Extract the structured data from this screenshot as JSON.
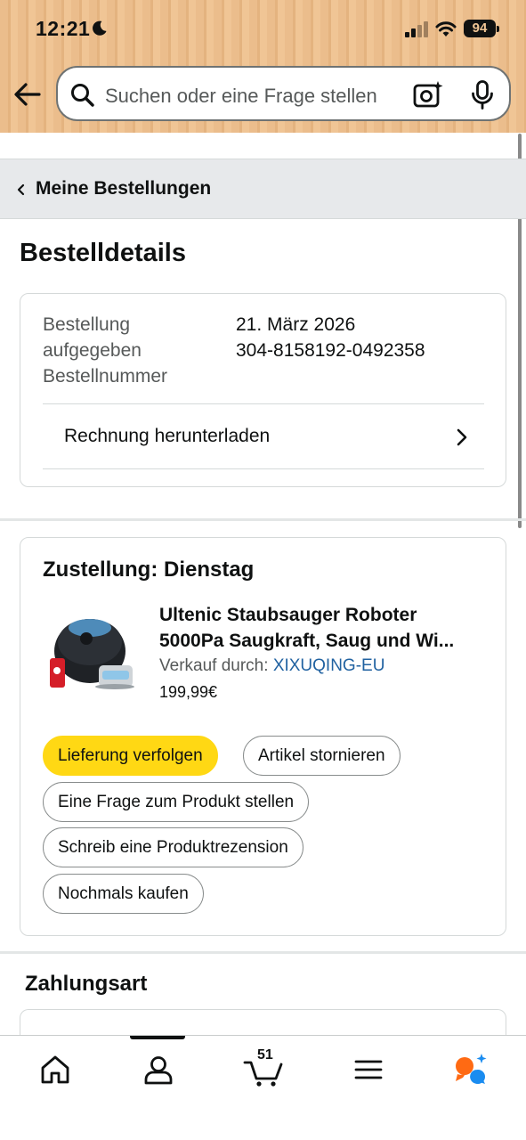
{
  "status_bar": {
    "time": "12:21",
    "battery": "94"
  },
  "search": {
    "placeholder": "Suchen oder eine Frage stellen"
  },
  "breadcrumb": {
    "label": "Meine Bestellungen"
  },
  "page": {
    "title": "Bestelldetails"
  },
  "order": {
    "placed_label": "Bestellung aufgegeben",
    "placed_value": "21. März 2026",
    "number_label": "Bestellnummer",
    "number_value": "304-8158192-0492358",
    "invoice_link": "Rechnung herunterladen"
  },
  "delivery": {
    "title": "Zustellung: Dienstag",
    "product_line1": "Ultenic Staubsauger Roboter",
    "product_line2": "5000Pa Saugkraft, Saug und Wi...",
    "seller_prefix": "Verkauf durch:",
    "seller_name": "XIXUQING-EU",
    "price": "199,99€",
    "buttons": {
      "track": "Lieferung verfolgen",
      "cancel": "Artikel stornieren",
      "ask": "Eine Frage zum Produkt stellen",
      "review": "Schreib eine Produktrezension",
      "buy_again": "Nochmals kaufen"
    }
  },
  "payment": {
    "title": "Zahlungsart"
  },
  "bottom_nav": {
    "cart_count": "51"
  },
  "colors": {
    "accent_button": "#ffd814",
    "link": "#2162a1",
    "header_bg": "#ebbd8c"
  }
}
